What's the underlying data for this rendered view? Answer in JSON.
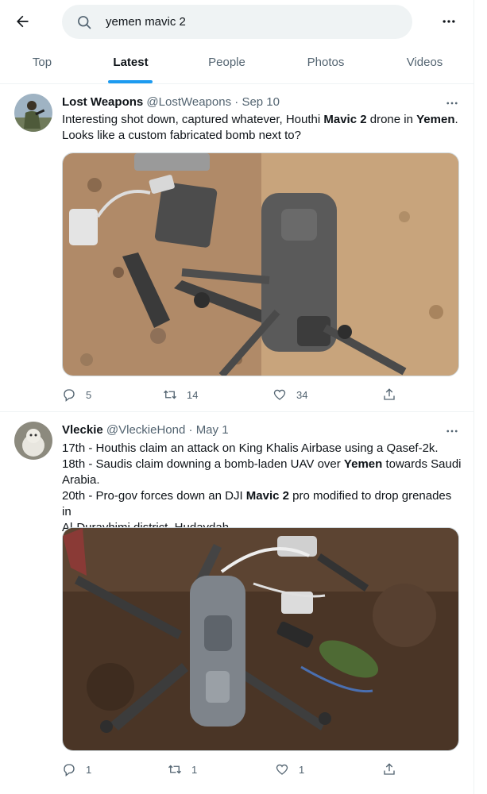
{
  "search": {
    "query": "yemen mavic 2"
  },
  "tabs": [
    {
      "label": "Top"
    },
    {
      "label": "Latest"
    },
    {
      "label": "People"
    },
    {
      "label": "Photos"
    },
    {
      "label": "Videos"
    }
  ],
  "active_tab": "Latest",
  "colors": {
    "accent": "#1d9bf0",
    "text": "#0f1419",
    "secondary_text": "#536471",
    "search_bg": "#eff3f4"
  },
  "tweets": [
    {
      "name": "Lost Weapons",
      "handle": "@LostWeapons",
      "separator": "·",
      "date": "Sep 10",
      "text_parts": [
        "Interesting shot down, captured whatever, Houthi ",
        "Mavic 2",
        " drone in ",
        "Yemen",
        ".",
        "Looks like a custom fabricated bomb next to?"
      ],
      "replies": "5",
      "retweets": "14",
      "likes": "34"
    },
    {
      "name": "Vleckie",
      "handle": "@VleckieHond",
      "separator": "·",
      "date": "May 1",
      "lines": {
        "l1": "17th - Houthis claim an attack on King Khalis Airbase using a Qasef-2k.",
        "l2a": "18th - Saudis claim downing a bomb-laden UAV over ",
        "l2b": "Yemen",
        "l2c": " towards Saudi",
        "l3": "Arabia.",
        "l4a": "20th - Pro-gov forces down an DJI ",
        "l4b": "Mavic 2",
        "l4c": " pro modified to drop grenades in",
        "l5": "Al-Durayhimi district, Hudaydah."
      },
      "replies": "1",
      "retweets": "1",
      "likes": "1"
    }
  ],
  "icons": {
    "back": "arrow-left-icon",
    "search": "search-icon",
    "more": "more-horizontal-icon",
    "reply": "reply-icon",
    "retweet": "retweet-icon",
    "like": "heart-icon",
    "share": "share-icon"
  }
}
